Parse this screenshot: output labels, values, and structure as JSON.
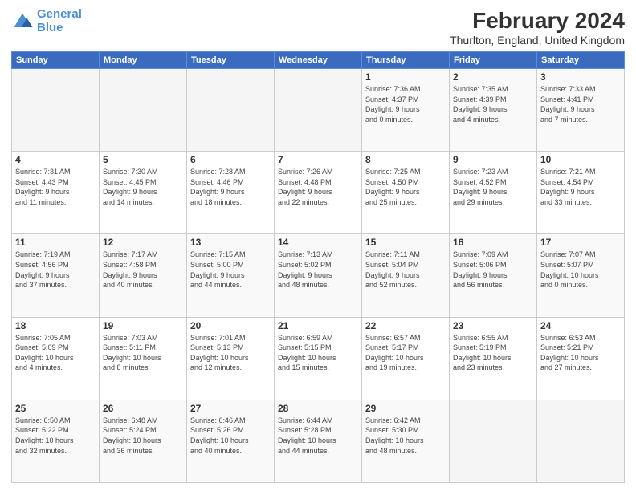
{
  "logo": {
    "line1": "General",
    "line2": "Blue"
  },
  "title": "February 2024",
  "subtitle": "Thurlton, England, United Kingdom",
  "days_of_week": [
    "Sunday",
    "Monday",
    "Tuesday",
    "Wednesday",
    "Thursday",
    "Friday",
    "Saturday"
  ],
  "weeks": [
    [
      {
        "day": "",
        "info": ""
      },
      {
        "day": "",
        "info": ""
      },
      {
        "day": "",
        "info": ""
      },
      {
        "day": "",
        "info": ""
      },
      {
        "day": "1",
        "info": "Sunrise: 7:36 AM\nSunset: 4:37 PM\nDaylight: 9 hours\nand 0 minutes."
      },
      {
        "day": "2",
        "info": "Sunrise: 7:35 AM\nSunset: 4:39 PM\nDaylight: 9 hours\nand 4 minutes."
      },
      {
        "day": "3",
        "info": "Sunrise: 7:33 AM\nSunset: 4:41 PM\nDaylight: 9 hours\nand 7 minutes."
      }
    ],
    [
      {
        "day": "4",
        "info": "Sunrise: 7:31 AM\nSunset: 4:43 PM\nDaylight: 9 hours\nand 11 minutes."
      },
      {
        "day": "5",
        "info": "Sunrise: 7:30 AM\nSunset: 4:45 PM\nDaylight: 9 hours\nand 14 minutes."
      },
      {
        "day": "6",
        "info": "Sunrise: 7:28 AM\nSunset: 4:46 PM\nDaylight: 9 hours\nand 18 minutes."
      },
      {
        "day": "7",
        "info": "Sunrise: 7:26 AM\nSunset: 4:48 PM\nDaylight: 9 hours\nand 22 minutes."
      },
      {
        "day": "8",
        "info": "Sunrise: 7:25 AM\nSunset: 4:50 PM\nDaylight: 9 hours\nand 25 minutes."
      },
      {
        "day": "9",
        "info": "Sunrise: 7:23 AM\nSunset: 4:52 PM\nDaylight: 9 hours\nand 29 minutes."
      },
      {
        "day": "10",
        "info": "Sunrise: 7:21 AM\nSunset: 4:54 PM\nDaylight: 9 hours\nand 33 minutes."
      }
    ],
    [
      {
        "day": "11",
        "info": "Sunrise: 7:19 AM\nSunset: 4:56 PM\nDaylight: 9 hours\nand 37 minutes."
      },
      {
        "day": "12",
        "info": "Sunrise: 7:17 AM\nSunset: 4:58 PM\nDaylight: 9 hours\nand 40 minutes."
      },
      {
        "day": "13",
        "info": "Sunrise: 7:15 AM\nSunset: 5:00 PM\nDaylight: 9 hours\nand 44 minutes."
      },
      {
        "day": "14",
        "info": "Sunrise: 7:13 AM\nSunset: 5:02 PM\nDaylight: 9 hours\nand 48 minutes."
      },
      {
        "day": "15",
        "info": "Sunrise: 7:11 AM\nSunset: 5:04 PM\nDaylight: 9 hours\nand 52 minutes."
      },
      {
        "day": "16",
        "info": "Sunrise: 7:09 AM\nSunset: 5:06 PM\nDaylight: 9 hours\nand 56 minutes."
      },
      {
        "day": "17",
        "info": "Sunrise: 7:07 AM\nSunset: 5:07 PM\nDaylight: 10 hours\nand 0 minutes."
      }
    ],
    [
      {
        "day": "18",
        "info": "Sunrise: 7:05 AM\nSunset: 5:09 PM\nDaylight: 10 hours\nand 4 minutes."
      },
      {
        "day": "19",
        "info": "Sunrise: 7:03 AM\nSunset: 5:11 PM\nDaylight: 10 hours\nand 8 minutes."
      },
      {
        "day": "20",
        "info": "Sunrise: 7:01 AM\nSunset: 5:13 PM\nDaylight: 10 hours\nand 12 minutes."
      },
      {
        "day": "21",
        "info": "Sunrise: 6:59 AM\nSunset: 5:15 PM\nDaylight: 10 hours\nand 15 minutes."
      },
      {
        "day": "22",
        "info": "Sunrise: 6:57 AM\nSunset: 5:17 PM\nDaylight: 10 hours\nand 19 minutes."
      },
      {
        "day": "23",
        "info": "Sunrise: 6:55 AM\nSunset: 5:19 PM\nDaylight: 10 hours\nand 23 minutes."
      },
      {
        "day": "24",
        "info": "Sunrise: 6:53 AM\nSunset: 5:21 PM\nDaylight: 10 hours\nand 27 minutes."
      }
    ],
    [
      {
        "day": "25",
        "info": "Sunrise: 6:50 AM\nSunset: 5:22 PM\nDaylight: 10 hours\nand 32 minutes."
      },
      {
        "day": "26",
        "info": "Sunrise: 6:48 AM\nSunset: 5:24 PM\nDaylight: 10 hours\nand 36 minutes."
      },
      {
        "day": "27",
        "info": "Sunrise: 6:46 AM\nSunset: 5:26 PM\nDaylight: 10 hours\nand 40 minutes."
      },
      {
        "day": "28",
        "info": "Sunrise: 6:44 AM\nSunset: 5:28 PM\nDaylight: 10 hours\nand 44 minutes."
      },
      {
        "day": "29",
        "info": "Sunrise: 6:42 AM\nSunset: 5:30 PM\nDaylight: 10 hours\nand 48 minutes."
      },
      {
        "day": "",
        "info": ""
      },
      {
        "day": "",
        "info": ""
      }
    ]
  ]
}
